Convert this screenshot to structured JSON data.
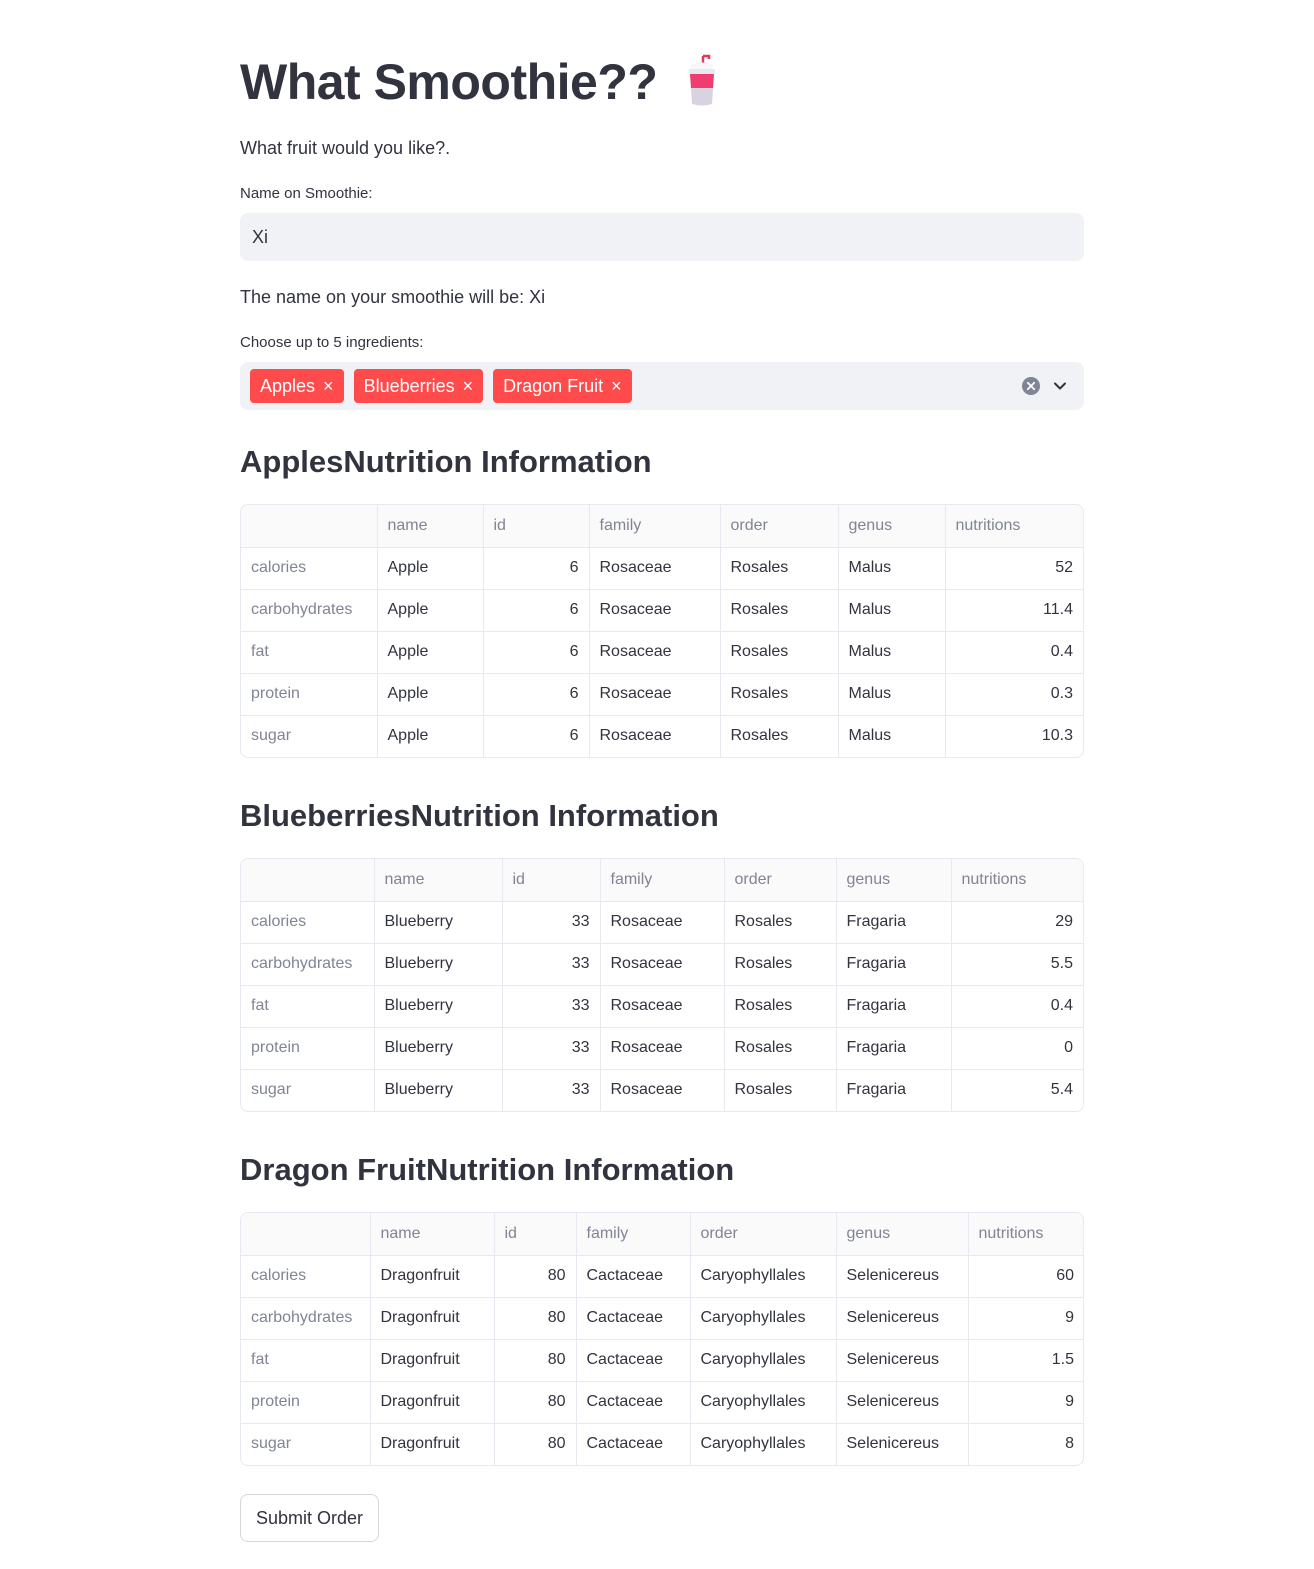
{
  "header": {
    "title": "What Smoothie??",
    "subtitle": "What fruit would you like?."
  },
  "name_field": {
    "label": "Name on Smoothie:",
    "value": "Xi"
  },
  "echo": "The name on your smoothie will be: Xi",
  "ingredients": {
    "label": "Choose up to 5 ingredients:",
    "selected": [
      "Apples",
      "Blueberries",
      "Dragon Fruit"
    ],
    "remove_glyph": "×"
  },
  "columns": [
    "",
    "name",
    "id",
    "family",
    "order",
    "genus",
    "nutritions"
  ],
  "sections": [
    {
      "heading": "ApplesNutrition Information",
      "col_widths": [
        136,
        106,
        106,
        131,
        118,
        107,
        138
      ],
      "rows": [
        [
          "calories",
          "Apple",
          "6",
          "Rosaceae",
          "Rosales",
          "Malus",
          "52"
        ],
        [
          "carbohydrates",
          "Apple",
          "6",
          "Rosaceae",
          "Rosales",
          "Malus",
          "11.4"
        ],
        [
          "fat",
          "Apple",
          "6",
          "Rosaceae",
          "Rosales",
          "Malus",
          "0.4"
        ],
        [
          "protein",
          "Apple",
          "6",
          "Rosaceae",
          "Rosales",
          "Malus",
          "0.3"
        ],
        [
          "sugar",
          "Apple",
          "6",
          "Rosaceae",
          "Rosales",
          "Malus",
          "10.3"
        ]
      ]
    },
    {
      "heading": "BlueberriesNutrition Information",
      "col_widths": [
        133,
        128,
        98,
        124,
        112,
        115,
        132
      ],
      "rows": [
        [
          "calories",
          "Blueberry",
          "33",
          "Rosaceae",
          "Rosales",
          "Fragaria",
          "29"
        ],
        [
          "carbohydrates",
          "Blueberry",
          "33",
          "Rosaceae",
          "Rosales",
          "Fragaria",
          "5.5"
        ],
        [
          "fat",
          "Blueberry",
          "33",
          "Rosaceae",
          "Rosales",
          "Fragaria",
          "0.4"
        ],
        [
          "protein",
          "Blueberry",
          "33",
          "Rosaceae",
          "Rosales",
          "Fragaria",
          "0"
        ],
        [
          "sugar",
          "Blueberry",
          "33",
          "Rosaceae",
          "Rosales",
          "Fragaria",
          "5.4"
        ]
      ]
    },
    {
      "heading": "Dragon FruitNutrition Information",
      "col_widths": [
        129,
        124,
        82,
        114,
        146,
        132,
        116
      ],
      "rows": [
        [
          "calories",
          "Dragonfruit",
          "80",
          "Cactaceae",
          "Caryophyllales",
          "Selenicereus",
          "60"
        ],
        [
          "carbohydrates",
          "Dragonfruit",
          "80",
          "Cactaceae",
          "Caryophyllales",
          "Selenicereus",
          "9"
        ],
        [
          "fat",
          "Dragonfruit",
          "80",
          "Cactaceae",
          "Caryophyllales",
          "Selenicereus",
          "1.5"
        ],
        [
          "protein",
          "Dragonfruit",
          "80",
          "Cactaceae",
          "Caryophyllales",
          "Selenicereus",
          "9"
        ],
        [
          "sugar",
          "Dragonfruit",
          "80",
          "Cactaceae",
          "Caryophyllales",
          "Selenicereus",
          "8"
        ]
      ]
    }
  ],
  "icons": {
    "title": "cup-with-straw-icon",
    "clear": "clear-circle-icon",
    "dropdown": "chevron-down-icon"
  },
  "colors": {
    "accent": "#ff4b4b",
    "text": "#31333f",
    "muted": "#808495",
    "input_bg": "#f0f2f6"
  },
  "submit_label": "Submit Order"
}
